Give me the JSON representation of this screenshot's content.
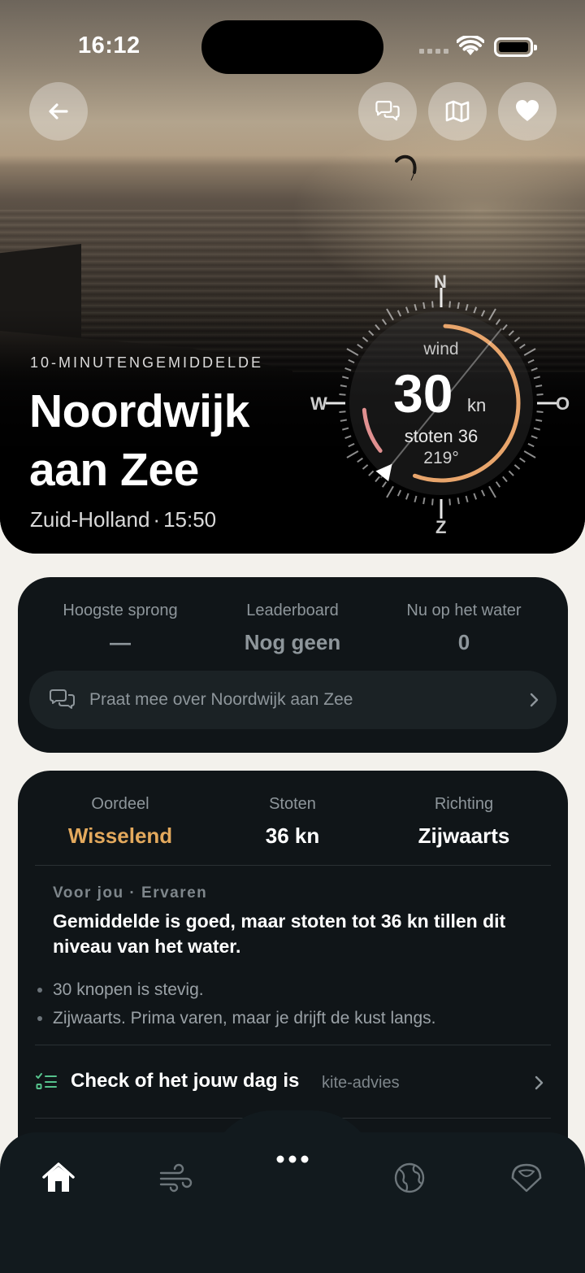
{
  "status_bar": {
    "time": "16:12"
  },
  "header": {
    "back_icon": "arrow-left-icon",
    "actions": [
      {
        "name": "chat",
        "icon": "chat-bubbles-icon"
      },
      {
        "name": "map",
        "icon": "map-icon"
      },
      {
        "name": "favorite",
        "icon": "heart-icon"
      }
    ]
  },
  "hero": {
    "kicker": "10-MINUTENGEMIDDELDE",
    "title": "Noordwijk aan Zee",
    "region": "Zuid-Holland",
    "separator": "·",
    "time": "15:50"
  },
  "compass": {
    "north": "N",
    "east": "O",
    "south": "Z",
    "west": "W",
    "label": "wind",
    "speed": "30",
    "unit": "kn",
    "gusts": "stoten 36",
    "direction": "219°",
    "direction_degrees": 219,
    "arc_colors": [
      "#e8a56c",
      "#e8b07a",
      "#e09090"
    ]
  },
  "community": {
    "stats": [
      {
        "label": "Hoogste sprong",
        "value": "—"
      },
      {
        "label": "Leaderboard",
        "value": "Nog geen"
      },
      {
        "label": "Nu op het water",
        "value": "0"
      }
    ],
    "chat_label": "Praat mee over Noordwijk aan Zee"
  },
  "conditions": {
    "verdict": {
      "label": "Oordeel",
      "value": "Wisselend",
      "color": "#e3a95d"
    },
    "gusts": {
      "label": "Stoten",
      "value": "36 kn"
    },
    "direction": {
      "label": "Richting",
      "value": "Zijwaarts"
    },
    "advice_kicker": "Voor jou · Ervaren",
    "advice_title": "Gemiddelde is goed, maar stoten tot 36 kn tillen dit niveau van het water.",
    "bullets": [
      "30 knopen is stevig.",
      "Zijwaarts. Prima varen, maar je drijft de kust langs."
    ],
    "check_label": "Check of het jouw dag is",
    "check_tag": "kite-advies"
  },
  "tabbar": {
    "items": [
      {
        "name": "home",
        "icon": "house-icon",
        "active": true
      },
      {
        "name": "wind",
        "icon": "wind-icon",
        "active": false
      },
      {
        "name": "more",
        "icon": "more-dots-icon",
        "active": false
      },
      {
        "name": "world",
        "icon": "globe-icon",
        "active": false
      },
      {
        "name": "kite",
        "icon": "kite-icon",
        "active": false
      }
    ]
  }
}
